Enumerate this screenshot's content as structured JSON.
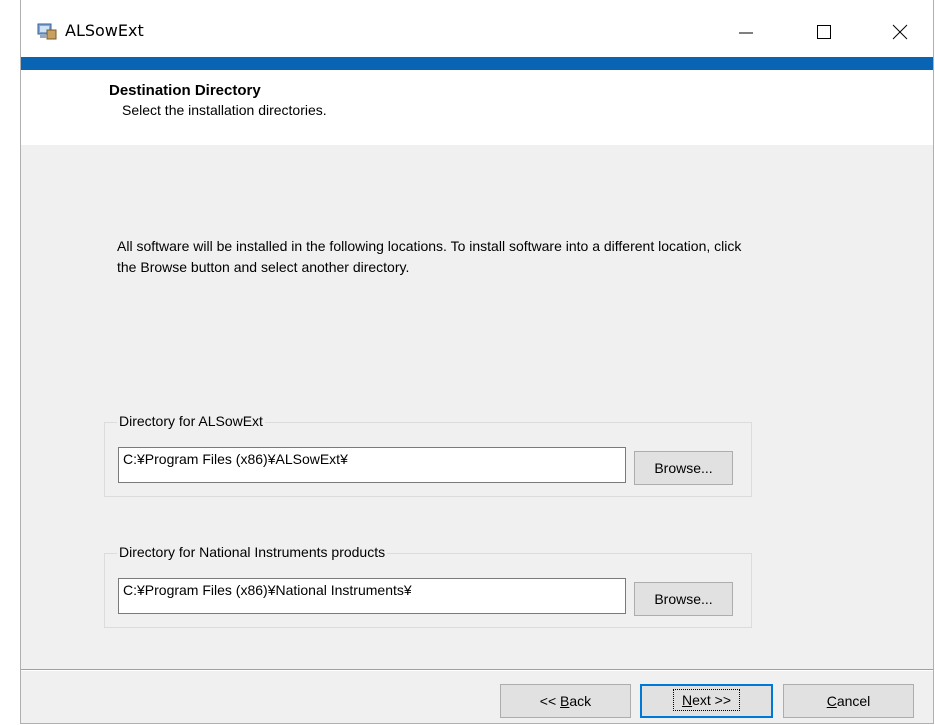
{
  "window": {
    "title": "ALSowExt"
  },
  "header": {
    "title": "Destination Directory",
    "subtitle": "Select the installation directories."
  },
  "description": "All software will be installed in the following locations. To install software into a different location, click the Browse button and select another directory.",
  "groups": [
    {
      "label": "Directory for ALSowExt",
      "path": "C:¥Program Files (x86)¥ALSowExt¥",
      "browse_label": "Browse..."
    },
    {
      "label": "Directory for National Instruments products",
      "path": "C:¥Program Files (x86)¥National Instruments¥",
      "browse_label": "Browse..."
    }
  ],
  "footer": {
    "back_prefix": "<< ",
    "back_accel": "B",
    "back_rest": "ack",
    "next_accel": "N",
    "next_rest": "ext >>",
    "cancel_accel": "C",
    "cancel_rest": "ancel"
  }
}
